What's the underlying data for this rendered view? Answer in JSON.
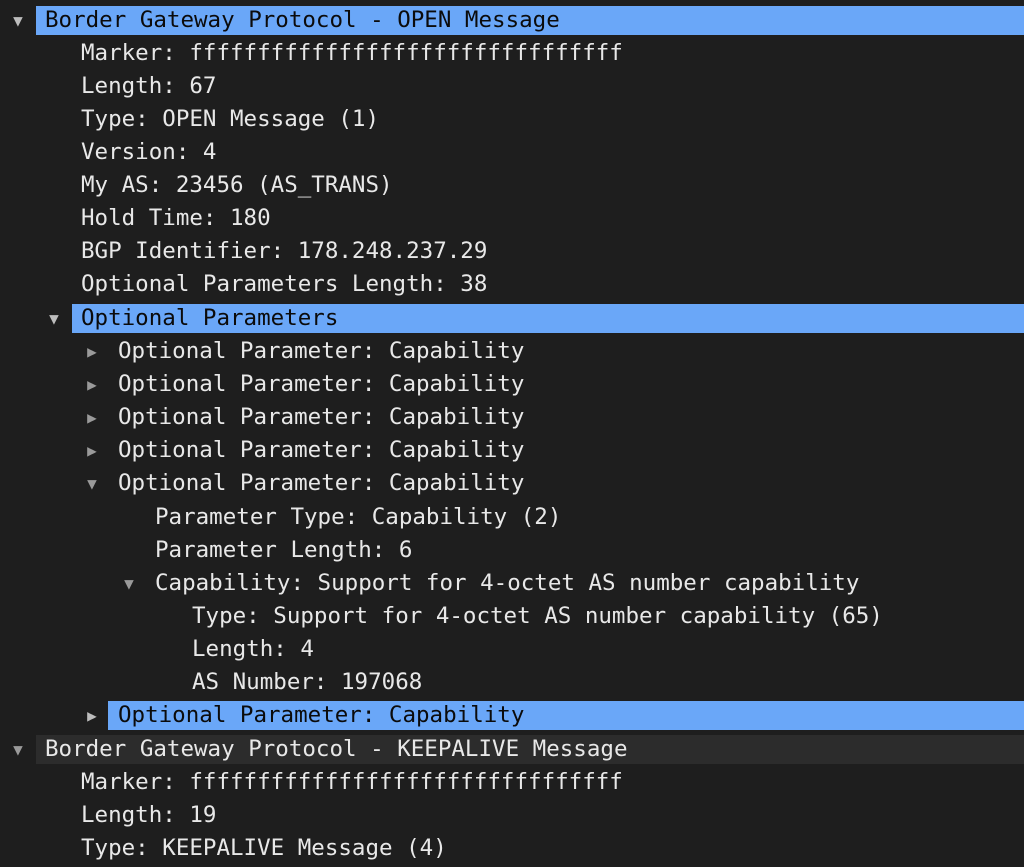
{
  "tree": {
    "rows": [
      {
        "label": "Border Gateway Protocol - OPEN Message",
        "expander": "expanded"
      },
      {
        "label": "Marker: ffffffffffffffffffffffffffffffff",
        "expander": "none"
      },
      {
        "label": "Length: 67",
        "expander": "none"
      },
      {
        "label": "Type: OPEN Message (1)",
        "expander": "none"
      },
      {
        "label": "Version: 4",
        "expander": "none"
      },
      {
        "label": "My AS: 23456 (AS_TRANS)",
        "expander": "none"
      },
      {
        "label": "Hold Time: 180",
        "expander": "none"
      },
      {
        "label": "BGP Identifier: 178.248.237.29",
        "expander": "none"
      },
      {
        "label": "Optional Parameters Length: 38",
        "expander": "none"
      },
      {
        "label": "Optional Parameters",
        "expander": "expanded"
      },
      {
        "label": "Optional Parameter: Capability",
        "expander": "collapsed"
      },
      {
        "label": "Optional Parameter: Capability",
        "expander": "collapsed"
      },
      {
        "label": "Optional Parameter: Capability",
        "expander": "collapsed"
      },
      {
        "label": "Optional Parameter: Capability",
        "expander": "collapsed"
      },
      {
        "label": "Optional Parameter: Capability",
        "expander": "expanded"
      },
      {
        "label": "Parameter Type: Capability (2)",
        "expander": "none"
      },
      {
        "label": "Parameter Length: 6",
        "expander": "none"
      },
      {
        "label": "Capability: Support for 4-octet AS number capability",
        "expander": "expanded"
      },
      {
        "label": "Type: Support for 4-octet AS number capability (65)",
        "expander": "none"
      },
      {
        "label": "Length: 4",
        "expander": "none"
      },
      {
        "label": "AS Number: 197068",
        "expander": "none"
      },
      {
        "label": "Optional Parameter: Capability",
        "expander": "collapsed"
      },
      {
        "label": "Border Gateway Protocol - KEEPALIVE Message",
        "expander": "expanded"
      },
      {
        "label": "Marker: ffffffffffffffffffffffffffffffff",
        "expander": "none"
      },
      {
        "label": "Length: 19",
        "expander": "none"
      },
      {
        "label": "Type: KEEPALIVE Message (4)",
        "expander": "none"
      }
    ]
  },
  "colors": {
    "background": "#1e1e1e",
    "selection": "#6aa7f8",
    "text": "#e8e8e8",
    "selected_text": "#0b0b0b",
    "expander": "#9a9a9a"
  }
}
